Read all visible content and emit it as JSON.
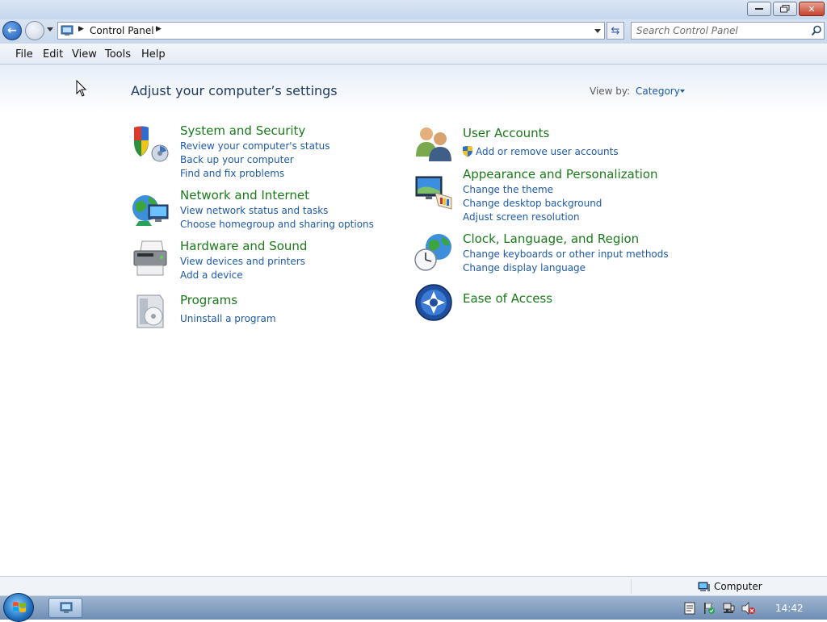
{
  "window": {
    "controls": {
      "minimize_icon": "minimize-icon",
      "maximize_icon": "restore-icon",
      "close_icon": "close-icon"
    }
  },
  "nav": {
    "address": "Control Panel",
    "search_placeholder": "Search Control Panel"
  },
  "menu": [
    "File",
    "Edit",
    "View",
    "Tools",
    "Help"
  ],
  "main": {
    "title": "Adjust your computer’s settings",
    "view_by_label": "View by:",
    "view_by_value": "Category",
    "left_categories": [
      {
        "title": "System and Security",
        "icon": "shield-icon",
        "links": [
          "Review your computer's status",
          "Back up your computer",
          "Find and fix problems"
        ]
      },
      {
        "title": "Network and Internet",
        "icon": "globe-network-icon",
        "links": [
          "View network status and tasks",
          "Choose homegroup and sharing options"
        ]
      },
      {
        "title": "Hardware and Sound",
        "icon": "printer-icon",
        "links": [
          "View devices and printers",
          "Add a device"
        ]
      },
      {
        "title": "Programs",
        "icon": "programs-icon",
        "links": [
          "Uninstall a program"
        ]
      }
    ],
    "right_categories": [
      {
        "title": "User Accounts",
        "icon": "users-icon",
        "links": [
          "Add or remove user accounts"
        ]
      },
      {
        "title": "Appearance and Personalization",
        "icon": "monitor-palette-icon",
        "links": [
          "Change the theme",
          "Change desktop background",
          "Adjust screen resolution"
        ]
      },
      {
        "title": "Clock, Language, and Region",
        "icon": "clock-globe-icon",
        "links": [
          "Change keyboards or other input methods",
          "Change display language"
        ]
      },
      {
        "title": "Ease of Access",
        "icon": "ease-of-access-icon",
        "links": []
      }
    ]
  },
  "status": {
    "text": "Computer"
  },
  "taskbar": {
    "clock": "14:42"
  },
  "colors": {
    "category_title": "#1a7a1a",
    "link": "#1e5aa8",
    "heading": "#1e395b"
  }
}
